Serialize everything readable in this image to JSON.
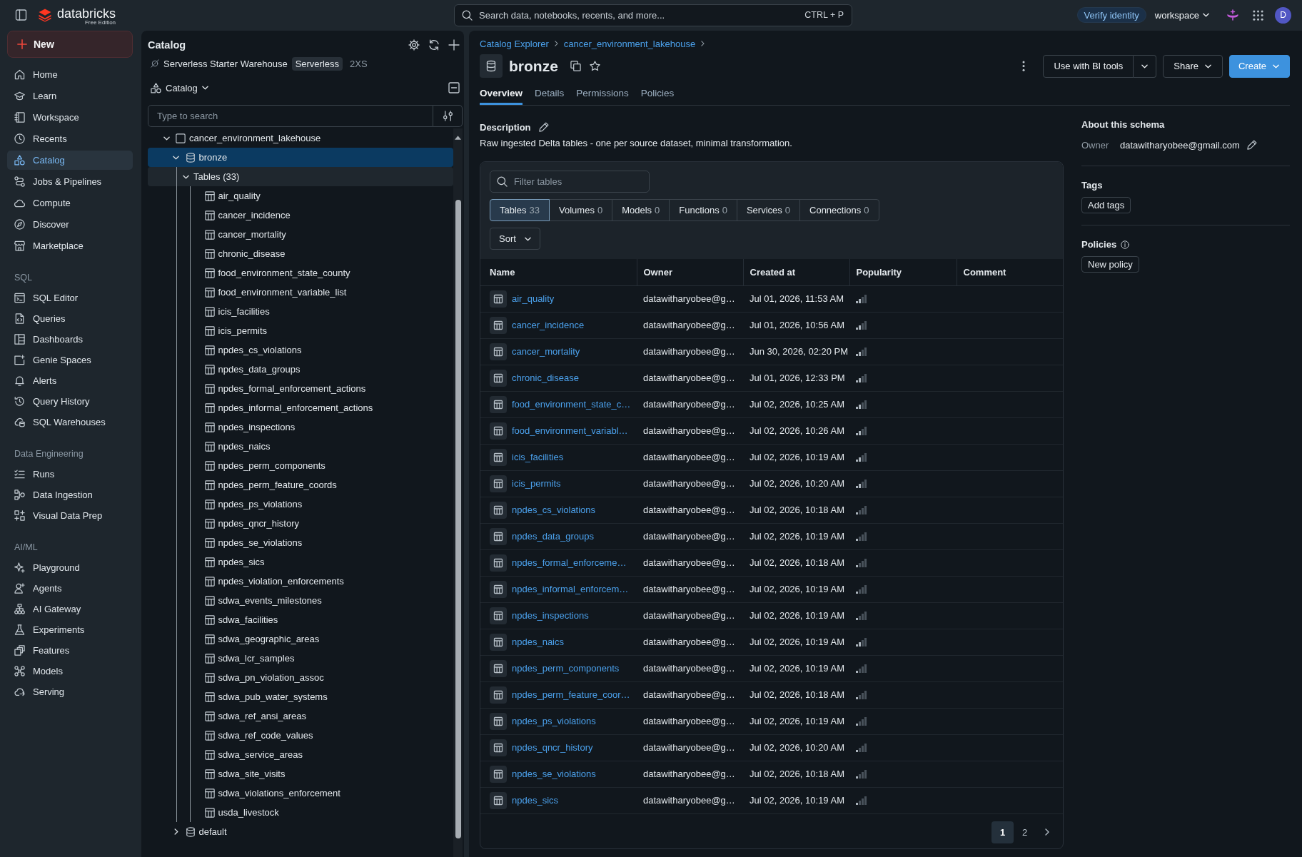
{
  "top_bar": {
    "brand": {
      "name": "databricks",
      "edition": "Free Edition"
    },
    "search": {
      "placeholder": "Search data, notebooks, recents, and more...",
      "shortcut": "CTRL + P"
    },
    "verify_identity": "Verify identity",
    "workspace": "workspace",
    "avatar": "D"
  },
  "sidebar": {
    "new_button": "New",
    "sections": [
      {
        "items": [
          {
            "label": "Home",
            "selected": false
          },
          {
            "label": "Learn",
            "selected": false
          },
          {
            "label": "Workspace",
            "selected": false
          },
          {
            "label": "Recents",
            "selected": false
          },
          {
            "label": "Catalog",
            "selected": true
          },
          {
            "label": "Jobs & Pipelines",
            "selected": false
          },
          {
            "label": "Compute",
            "selected": false
          },
          {
            "label": "Discover",
            "selected": false
          },
          {
            "label": "Marketplace",
            "selected": false
          }
        ]
      },
      {
        "heading": "SQL",
        "items": [
          {
            "label": "SQL Editor",
            "selected": false
          },
          {
            "label": "Queries",
            "selected": false
          },
          {
            "label": "Dashboards",
            "selected": false
          },
          {
            "label": "Genie Spaces",
            "selected": false
          },
          {
            "label": "Alerts",
            "selected": false
          },
          {
            "label": "Query History",
            "selected": false
          },
          {
            "label": "SQL Warehouses",
            "selected": false
          }
        ]
      },
      {
        "heading": "Data Engineering",
        "items": [
          {
            "label": "Runs",
            "selected": false
          },
          {
            "label": "Data Ingestion",
            "selected": false
          },
          {
            "label": "Visual Data Prep",
            "selected": false
          }
        ]
      },
      {
        "heading": "AI/ML",
        "items": [
          {
            "label": "Playground",
            "selected": false
          },
          {
            "label": "Agents",
            "selected": false
          },
          {
            "label": "AI Gateway",
            "selected": false
          },
          {
            "label": "Experiments",
            "selected": false
          },
          {
            "label": "Features",
            "selected": false
          },
          {
            "label": "Models",
            "selected": false
          },
          {
            "label": "Serving",
            "selected": false
          }
        ]
      }
    ]
  },
  "catalog_panel": {
    "title": "Catalog",
    "warehouse": {
      "name": "Serverless Starter Warehouse",
      "type": "Serverless",
      "size": "2XS"
    },
    "scope": "Catalog",
    "search": {
      "placeholder": "Type to search"
    },
    "tree": [
      {
        "kind": "catalog",
        "label": "cancer_environment_lakehouse",
        "expanded": true,
        "selected": false,
        "hovered": false,
        "children": [
          {
            "kind": "schema",
            "label": "bronze",
            "expanded": true,
            "selected": true,
            "hovered": false,
            "children": [
              {
                "label": "Tables (33)",
                "expanded": true,
                "selected": false,
                "hovered": true,
                "children": [
                  {
                    "kind": "table",
                    "label": "air_quality",
                    "selected": false
                  },
                  {
                    "kind": "table",
                    "label": "cancer_incidence",
                    "selected": false
                  },
                  {
                    "kind": "table",
                    "label": "cancer_mortality",
                    "selected": false
                  },
                  {
                    "kind": "table",
                    "label": "chronic_disease",
                    "selected": false
                  },
                  {
                    "kind": "table",
                    "label": "food_environment_state_county",
                    "selected": false
                  },
                  {
                    "kind": "table",
                    "label": "food_environment_variable_list",
                    "selected": false
                  },
                  {
                    "kind": "table",
                    "label": "icis_facilities",
                    "selected": false
                  },
                  {
                    "kind": "table",
                    "label": "icis_permits",
                    "selected": false
                  },
                  {
                    "kind": "table",
                    "label": "npdes_cs_violations",
                    "selected": false
                  },
                  {
                    "kind": "table",
                    "label": "npdes_data_groups",
                    "selected": false
                  },
                  {
                    "kind": "table",
                    "label": "npdes_formal_enforcement_actions",
                    "selected": false
                  },
                  {
                    "kind": "table",
                    "label": "npdes_informal_enforcement_actions",
                    "selected": false
                  },
                  {
                    "kind": "table",
                    "label": "npdes_inspections",
                    "selected": false
                  },
                  {
                    "kind": "table",
                    "label": "npdes_naics",
                    "selected": false
                  },
                  {
                    "kind": "table",
                    "label": "npdes_perm_components",
                    "selected": false
                  },
                  {
                    "kind": "table",
                    "label": "npdes_perm_feature_coords",
                    "selected": false
                  },
                  {
                    "kind": "table",
                    "label": "npdes_ps_violations",
                    "selected": false
                  },
                  {
                    "kind": "table",
                    "label": "npdes_qncr_history",
                    "selected": false
                  },
                  {
                    "kind": "table",
                    "label": "npdes_se_violations",
                    "selected": false
                  },
                  {
                    "kind": "table",
                    "label": "npdes_sics",
                    "selected": false
                  },
                  {
                    "kind": "table",
                    "label": "npdes_violation_enforcements",
                    "selected": false
                  },
                  {
                    "kind": "table",
                    "label": "sdwa_events_milestones",
                    "selected": false
                  },
                  {
                    "kind": "table",
                    "label": "sdwa_facilities",
                    "selected": false
                  },
                  {
                    "kind": "table",
                    "label": "sdwa_geographic_areas",
                    "selected": false
                  },
                  {
                    "kind": "table",
                    "label": "sdwa_lcr_samples",
                    "selected": false
                  },
                  {
                    "kind": "table",
                    "label": "sdwa_pn_violation_assoc",
                    "selected": false
                  },
                  {
                    "kind": "table",
                    "label": "sdwa_pub_water_systems",
                    "selected": false
                  },
                  {
                    "kind": "table",
                    "label": "sdwa_ref_ansi_areas",
                    "selected": false
                  },
                  {
                    "kind": "table",
                    "label": "sdwa_ref_code_values",
                    "selected": false
                  },
                  {
                    "kind": "table",
                    "label": "sdwa_service_areas",
                    "selected": false
                  },
                  {
                    "kind": "table",
                    "label": "sdwa_site_visits",
                    "selected": false
                  },
                  {
                    "kind": "table",
                    "label": "sdwa_violations_enforcement",
                    "selected": false
                  },
                  {
                    "kind": "table",
                    "label": "usda_livestock",
                    "selected": false
                  }
                ]
              }
            ]
          },
          {
            "kind": "schema",
            "label": "default",
            "expanded": false,
            "selected": false,
            "hovered": false
          }
        ]
      }
    ]
  },
  "main": {
    "breadcrumb": [
      {
        "label": "Catalog Explorer"
      },
      {
        "label": "cancer_environment_lakehouse"
      }
    ],
    "title": "bronze",
    "actions": {
      "bi_tools": "Use with BI tools",
      "share": "Share",
      "create": "Create"
    },
    "tabs": [
      {
        "label": "Overview",
        "selected": true
      },
      {
        "label": "Details",
        "selected": false
      },
      {
        "label": "Permissions",
        "selected": false
      },
      {
        "label": "Policies",
        "selected": false
      }
    ],
    "description": {
      "label": "Description",
      "text": "Raw ingested Delta tables - one per source dataset, minimal transformation."
    },
    "browser": {
      "filter": {
        "placeholder": "Filter tables"
      },
      "asset_tabs": [
        {
          "label": "Tables",
          "count": "33",
          "selected": true
        },
        {
          "label": "Volumes",
          "count": "0",
          "selected": false
        },
        {
          "label": "Models",
          "count": "0",
          "selected": false
        },
        {
          "label": "Functions",
          "count": "0",
          "selected": false
        },
        {
          "label": "Services",
          "count": "0",
          "selected": false
        },
        {
          "label": "Connections",
          "count": "0",
          "selected": false
        }
      ],
      "sort": "Sort",
      "table": {
        "columns": [
          "Name",
          "Owner",
          "Created at",
          "Popularity",
          "Comment"
        ],
        "rows": [
          {
            "name": "air_quality",
            "owner": "datawitharyobee@g…",
            "created_at": "Jul 01, 2026, 11:53 AM",
            "popularity": {
              "level": 0.5
            }
          },
          {
            "name": "cancer_incidence",
            "owner": "datawitharyobee@g…",
            "created_at": "Jul 01, 2026, 10:56 AM",
            "popularity": {
              "level": 0.5
            }
          },
          {
            "name": "cancer_mortality",
            "owner": "datawitharyobee@g…",
            "created_at": "Jun 30, 2026, 02:20 PM",
            "popularity": {
              "level": 0.5
            }
          },
          {
            "name": "chronic_disease",
            "owner": "datawitharyobee@g…",
            "created_at": "Jul 01, 2026, 12:33 PM",
            "popularity": {
              "level": 0.5
            }
          },
          {
            "name": "food_environment_state_c…",
            "owner": "datawitharyobee@g…",
            "created_at": "Jul 02, 2026, 10:25 AM",
            "popularity": {
              "level": 0.5
            }
          },
          {
            "name": "food_environment_variabl…",
            "owner": "datawitharyobee@g…",
            "created_at": "Jul 02, 2026, 10:26 AM",
            "popularity": {
              "level": 0.5
            }
          },
          {
            "name": "icis_facilities",
            "owner": "datawitharyobee@g…",
            "created_at": "Jul 02, 2026, 10:19 AM",
            "popularity": {
              "level": 0.5
            }
          },
          {
            "name": "icis_permits",
            "owner": "datawitharyobee@g…",
            "created_at": "Jul 02, 2026, 10:20 AM",
            "popularity": {
              "level": 0.5
            }
          },
          {
            "name": "npdes_cs_violations",
            "owner": "datawitharyobee@g…",
            "created_at": "Jul 02, 2026, 10:18 AM",
            "popularity": {
              "level": 0.25
            }
          },
          {
            "name": "npdes_data_groups",
            "owner": "datawitharyobee@g…",
            "created_at": "Jul 02, 2026, 10:19 AM",
            "popularity": {
              "level": 0.25
            }
          },
          {
            "name": "npdes_formal_enforceme…",
            "owner": "datawitharyobee@g…",
            "created_at": "Jul 02, 2026, 10:18 AM",
            "popularity": {
              "level": 0.25
            }
          },
          {
            "name": "npdes_informal_enforcem…",
            "owner": "datawitharyobee@g…",
            "created_at": "Jul 02, 2026, 10:19 AM",
            "popularity": {
              "level": 0.25
            }
          },
          {
            "name": "npdes_inspections",
            "owner": "datawitharyobee@g…",
            "created_at": "Jul 02, 2026, 10:19 AM",
            "popularity": {
              "level": 0.25
            }
          },
          {
            "name": "npdes_naics",
            "owner": "datawitharyobee@g…",
            "created_at": "Jul 02, 2026, 10:19 AM",
            "popularity": {
              "level": 0.5
            }
          },
          {
            "name": "npdes_perm_components",
            "owner": "datawitharyobee@g…",
            "created_at": "Jul 02, 2026, 10:19 AM",
            "popularity": {
              "level": 0.25
            }
          },
          {
            "name": "npdes_perm_feature_coor…",
            "owner": "datawitharyobee@g…",
            "created_at": "Jul 02, 2026, 10:18 AM",
            "popularity": {
              "level": 0.25
            }
          },
          {
            "name": "npdes_ps_violations",
            "owner": "datawitharyobee@g…",
            "created_at": "Jul 02, 2026, 10:19 AM",
            "popularity": {
              "level": 0.25
            }
          },
          {
            "name": "npdes_qncr_history",
            "owner": "datawitharyobee@g…",
            "created_at": "Jul 02, 2026, 10:20 AM",
            "popularity": {
              "level": 0.25
            }
          },
          {
            "name": "npdes_se_violations",
            "owner": "datawitharyobee@g…",
            "created_at": "Jul 02, 2026, 10:18 AM",
            "popularity": {
              "level": 0.25
            }
          },
          {
            "name": "npdes_sics",
            "owner": "datawitharyobee@g…",
            "created_at": "Jul 02, 2026, 10:19 AM",
            "popularity": {
              "level": 0.25
            }
          }
        ]
      },
      "pagination": [
        {
          "label": "1",
          "selected": true
        },
        {
          "label": "2",
          "selected": false
        }
      ]
    },
    "about": {
      "heading": "About this schema",
      "owner_label": "Owner",
      "owner": "datawitharyobee@gmail.com",
      "tags_heading": "Tags",
      "add_tags": "Add tags",
      "policies_heading": "Policies",
      "new_policy": "New policy"
    }
  }
}
